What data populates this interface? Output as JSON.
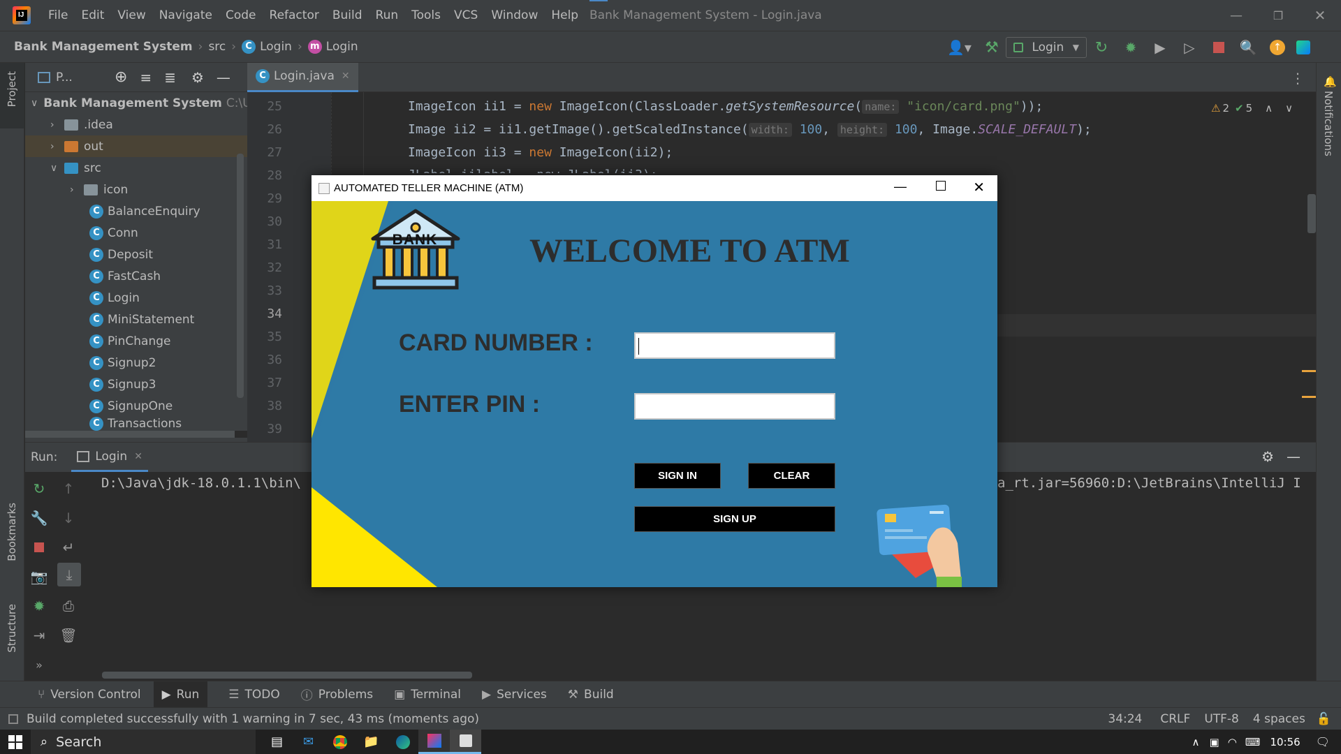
{
  "menu": [
    "File",
    "Edit",
    "View",
    "Navigate",
    "Code",
    "Refactor",
    "Build",
    "Run",
    "Tools",
    "VCS",
    "Window",
    "Help"
  ],
  "window_title": "Bank Management System - Login.java",
  "breadcrumb": {
    "project": "Bank Management System",
    "src": "src",
    "class": "Login",
    "method": "Login"
  },
  "run_config": "Login",
  "project_panel": {
    "title": "P...",
    "root": "Bank Management System",
    "root_path": "C:\\U",
    "items": [
      {
        "label": ".idea",
        "type": "folder"
      },
      {
        "label": "out",
        "type": "folder-orange"
      },
      {
        "label": "src",
        "type": "folder-blue"
      },
      {
        "label": "icon",
        "type": "folder"
      },
      {
        "label": "BalanceEnquiry",
        "type": "class"
      },
      {
        "label": "Conn",
        "type": "class"
      },
      {
        "label": "Deposit",
        "type": "class"
      },
      {
        "label": "FastCash",
        "type": "class"
      },
      {
        "label": "Login",
        "type": "class"
      },
      {
        "label": "MiniStatement",
        "type": "class"
      },
      {
        "label": "PinChange",
        "type": "class"
      },
      {
        "label": "Signup2",
        "type": "class"
      },
      {
        "label": "Signup3",
        "type": "class"
      },
      {
        "label": "SignupOne",
        "type": "class"
      },
      {
        "label": "Transactions",
        "type": "class"
      }
    ]
  },
  "editor": {
    "tab": "Login.java",
    "line_numbers": [
      "25",
      "26",
      "27",
      "28",
      "29",
      "30",
      "31",
      "32",
      "33",
      "34",
      "35",
      "36",
      "37",
      "38",
      "39"
    ],
    "warnings": "2",
    "checks": "5",
    "code": {
      "l25_a": "ImageIcon ii1 = ",
      "l25_new": "new",
      "l25_b": " ImageIcon(ClassLoader.",
      "l25_m": "getSystemResource",
      "l25_c": "(",
      "l25_hint": "name:",
      "l25_str": "\"icon/card.png\"",
      "l25_d": "));",
      "l26_a": "Image ii2 = ii1.getImage().getScaledInstance(",
      "l26_hint1": "width:",
      "l26_n1": "100",
      "l26_b": ", ",
      "l26_hint2": "height:",
      "l26_n2": "100",
      "l26_c": ", Image.",
      "l26_f": "SCALE_DEFAULT",
      "l26_d": ");",
      "l27_a": "ImageIcon ii3 = ",
      "l27_new": "new",
      "l27_b": " ImageIcon(ii2);",
      "l28": "JLabel iilabel = new JLabel(ii3);"
    }
  },
  "run_panel": {
    "label": "Run:",
    "tab": "Login",
    "output_left": "D:\\Java\\jdk-18.0.1.1\\bin\\",
    "output_right": "a_rt.jar=56960:D:\\JetBrains\\IntelliJ I"
  },
  "tool_windows": [
    "Version Control",
    "Run",
    "TODO",
    "Problems",
    "Terminal",
    "Services",
    "Build"
  ],
  "side_labels": {
    "project": "Project",
    "bookmarks": "Bookmarks",
    "structure": "Structure",
    "notifications": "Notifications"
  },
  "status": {
    "message": "Build completed successfully with 1 warning in 7 sec, 43 ms (moments ago)",
    "position": "34:24",
    "line_sep": "CRLF",
    "encoding": "UTF-8",
    "indent": "4 spaces"
  },
  "taskbar": {
    "search": "Search",
    "time": "10:56"
  },
  "atm": {
    "title": "AUTOMATED TELLER MACHINE (ATM)",
    "bank_label": "BANK",
    "welcome": "WELCOME TO ATM",
    "card_label": "CARD NUMBER :",
    "pin_label": "ENTER PIN :",
    "card_value": "",
    "pin_value": "",
    "sign_in": "SIGN IN",
    "clear": "CLEAR",
    "sign_up": "SIGN UP",
    "bg_color": "#2e7aa6",
    "accent_color": "#ffe600"
  }
}
